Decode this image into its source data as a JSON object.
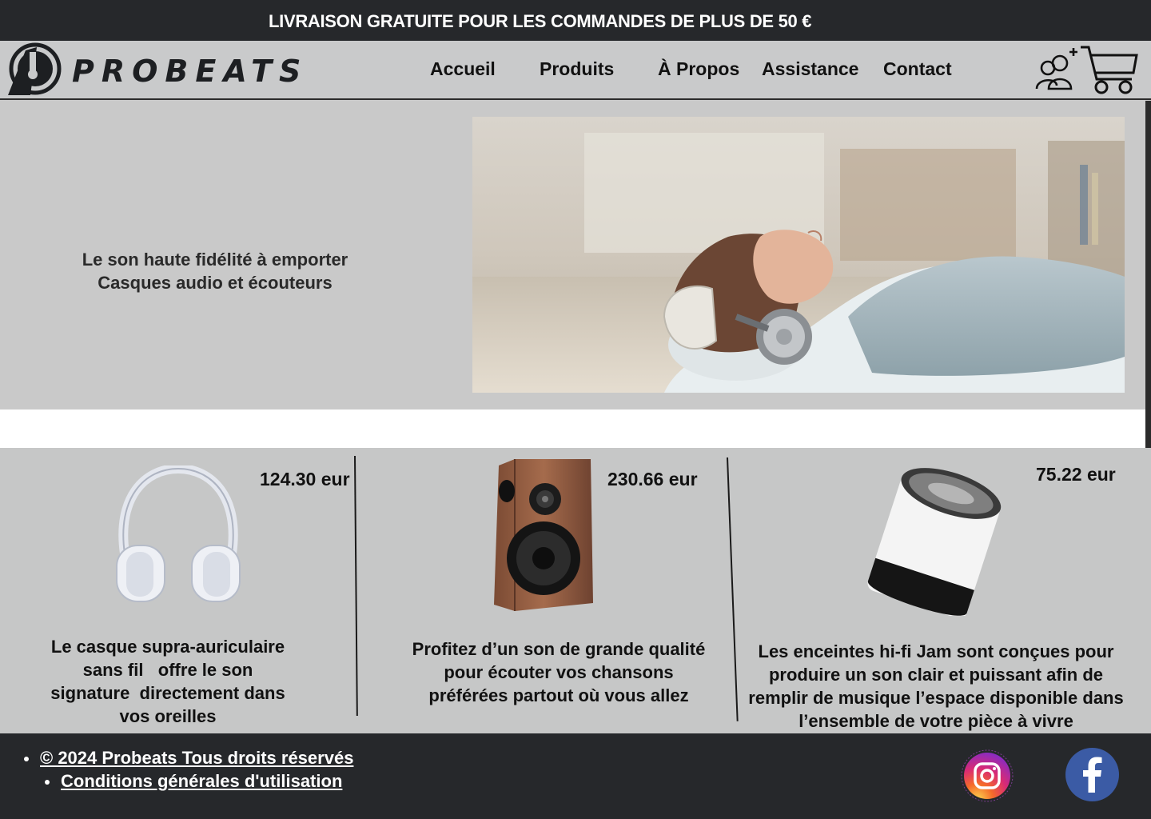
{
  "announcement": "LIVRAISON GRATUITE POUR LES COMMANDES DE PLUS DE 50 €",
  "brand": {
    "name": "PROBEATS"
  },
  "nav": {
    "items": [
      {
        "label": "Accueil"
      },
      {
        "label": "Produits"
      },
      {
        "label": "À Propos"
      },
      {
        "label": "Assistance"
      },
      {
        "label": "Contact"
      }
    ]
  },
  "header_icons": {
    "account": "add-user-icon",
    "cart": "cart-icon"
  },
  "hero": {
    "line1": "Le son haute fidélité à emporter",
    "line2": "Casques audio et écouteurs",
    "image": "woman-with-headphones-image"
  },
  "products": [
    {
      "price": "124.30 eur",
      "image": "white-headphones-image",
      "lines": [
        "Le casque supra-auriculaire",
        "sans fil   offre le son",
        "signature  directement dans",
        "vos oreilles"
      ]
    },
    {
      "price": "230.66 eur",
      "image": "wooden-speaker-image",
      "lines": [
        "Profitez d’un son de grande qualité",
        "pour écouter vos chansons",
        "préférées partout où vous allez"
      ]
    },
    {
      "price": "75.22 eur",
      "image": "jam-speaker-image",
      "lines": [
        "Les enceintes hi-fi Jam sont conçues pour",
        "produire un son clair et puissant afin de",
        "remplir de musique l’espace disponible dans",
        "l’ensemble de votre pièce à vivre"
      ]
    }
  ],
  "footer": {
    "copyright": "© 2024  Probeats Tous droits réservés",
    "terms": "Conditions générales d'utilisation",
    "social": [
      "instagram-icon",
      "facebook-icon"
    ]
  },
  "colors": {
    "dark": "#26282b",
    "panel": "#c9c9c9",
    "facebook": "#3b5ba5"
  }
}
